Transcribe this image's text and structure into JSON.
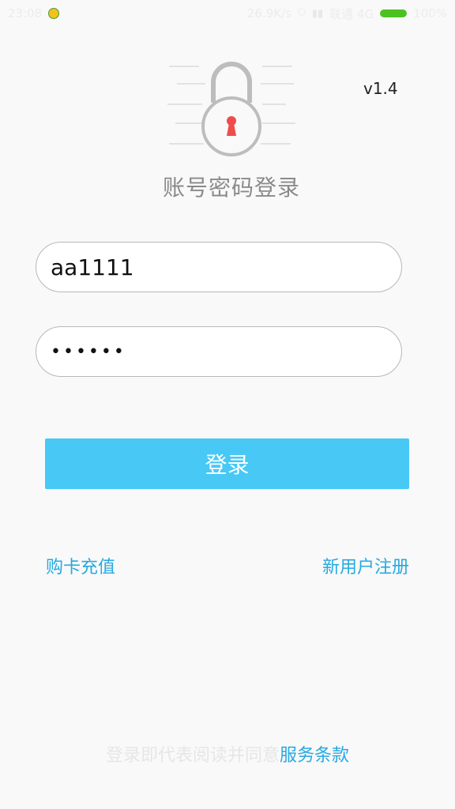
{
  "status_bar": {
    "time": "23:08",
    "speed": "26.9K/s",
    "network_label": "联通 4G",
    "battery": "100%"
  },
  "version": "v1.4",
  "page_title": "账号密码登录",
  "form": {
    "username_value": "aa1111",
    "password_value": "aaaaaa"
  },
  "login_button_label": "登录",
  "links": {
    "recharge": "购卡充值",
    "register": "新用户注册"
  },
  "terms": {
    "prefix": "登录即代表阅读并同意",
    "link": "服务条款"
  },
  "colors": {
    "accent": "#47c8f5",
    "link": "#26a9e1",
    "keyhole": "#f04c4c"
  }
}
